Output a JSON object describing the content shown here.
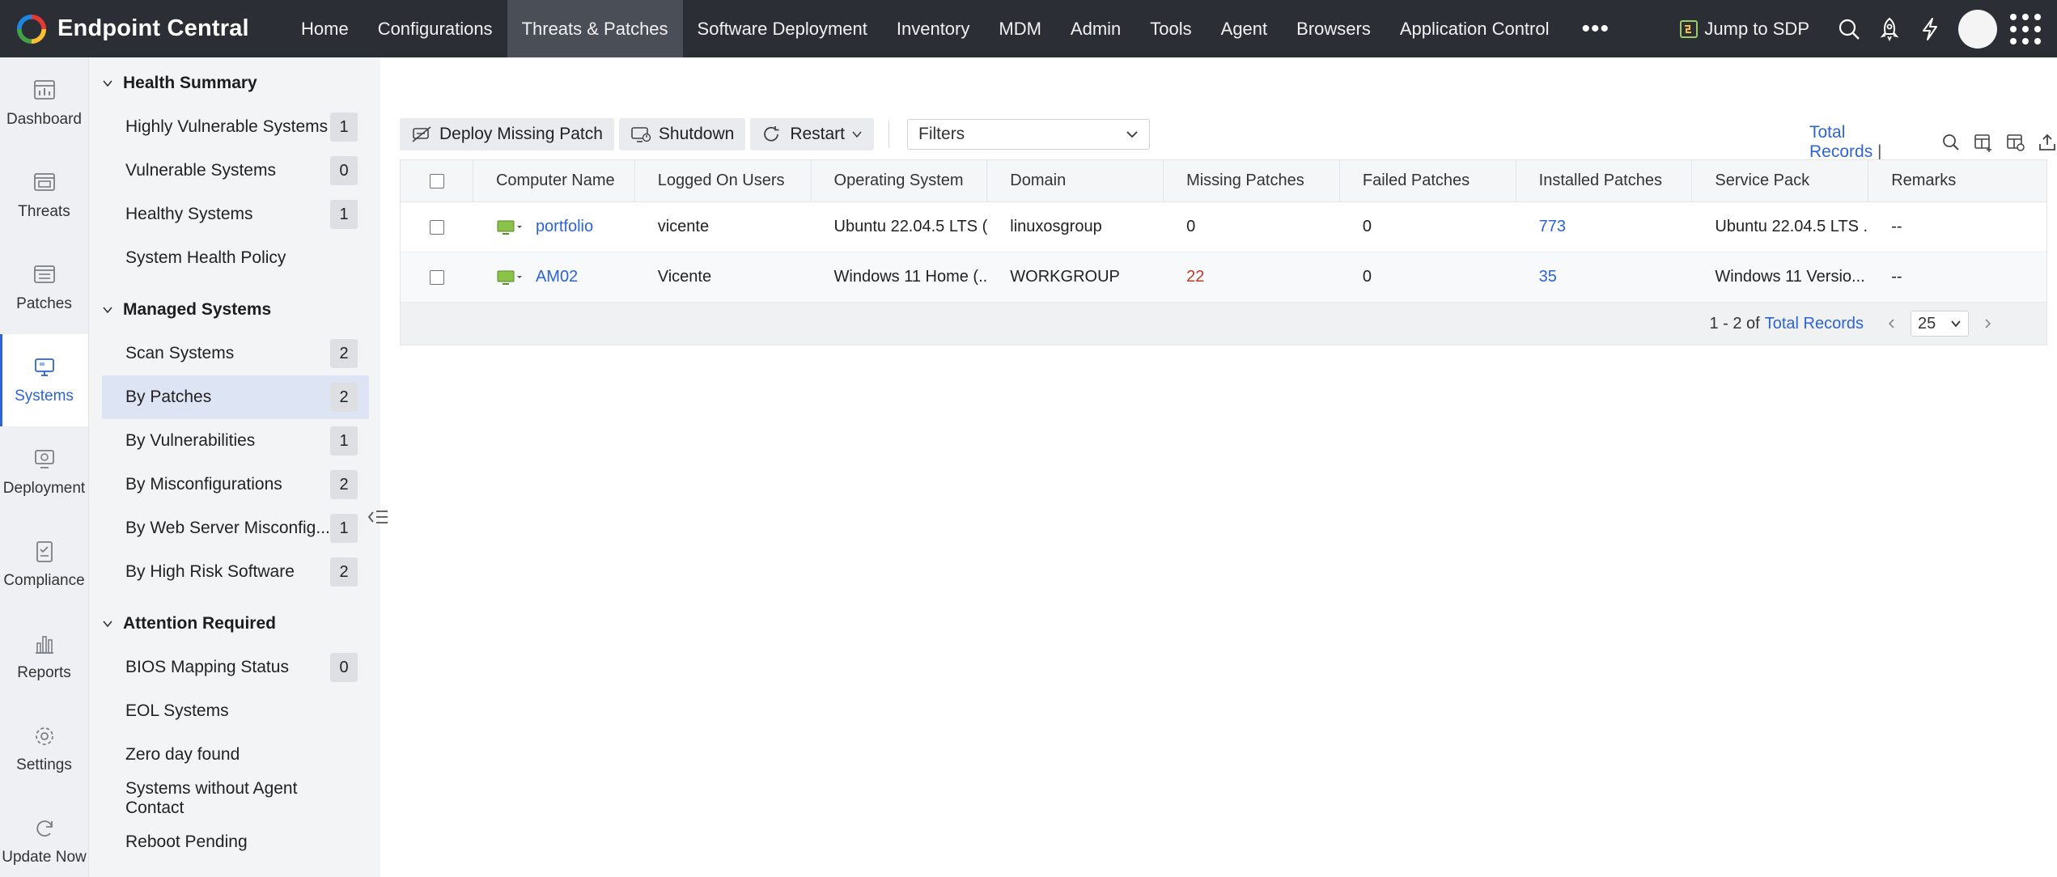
{
  "app": {
    "name": "Endpoint Central"
  },
  "nav": {
    "items": [
      "Home",
      "Configurations",
      "Threats & Patches",
      "Software Deployment",
      "Inventory",
      "MDM",
      "Admin",
      "Tools",
      "Agent",
      "Browsers",
      "Application Control"
    ],
    "active": "Threats & Patches",
    "more": "•••",
    "jump_label": "Jump to SDP"
  },
  "rail": [
    {
      "label": "Dashboard",
      "icon": "dashboard-icon"
    },
    {
      "label": "Threats",
      "icon": "threats-icon"
    },
    {
      "label": "Patches",
      "icon": "patches-icon"
    },
    {
      "label": "Systems",
      "icon": "systems-icon",
      "active": true
    },
    {
      "label": "Deployment",
      "icon": "deployment-icon"
    },
    {
      "label": "Compliance",
      "icon": "compliance-icon"
    },
    {
      "label": "Reports",
      "icon": "reports-icon"
    },
    {
      "label": "Settings",
      "icon": "settings-icon"
    },
    {
      "label": "Update Now",
      "icon": "update-icon"
    }
  ],
  "submenu": {
    "health": {
      "title": "Health Summary",
      "items": [
        {
          "label": "Highly Vulnerable Systems",
          "count": "1"
        },
        {
          "label": "Vulnerable Systems",
          "count": "0"
        },
        {
          "label": "Healthy Systems",
          "count": "1"
        },
        {
          "label": "System Health Policy",
          "count": ""
        }
      ]
    },
    "managed": {
      "title": "Managed Systems",
      "items": [
        {
          "label": "Scan Systems",
          "count": "2"
        },
        {
          "label": "By Patches",
          "count": "2",
          "active": true
        },
        {
          "label": "By Vulnerabilities",
          "count": "1"
        },
        {
          "label": "By Misconfigurations",
          "count": "2"
        },
        {
          "label": "By Web Server Misconfig...",
          "count": "1"
        },
        {
          "label": "By High Risk Software",
          "count": "2"
        }
      ]
    },
    "attention": {
      "title": "Attention Required",
      "items": [
        {
          "label": "BIOS Mapping Status",
          "count": "0"
        },
        {
          "label": "EOL Systems",
          "count": ""
        },
        {
          "label": "Zero day found",
          "count": ""
        },
        {
          "label": "Systems without Agent Contact",
          "count": ""
        },
        {
          "label": "Reboot Pending",
          "count": ""
        }
      ]
    }
  },
  "toolbar": {
    "deploy": "Deploy Missing Patch",
    "shutdown": "Shutdown",
    "restart": "Restart",
    "filters": "Filters",
    "total_records": "Total Records",
    "separator": "|"
  },
  "table": {
    "columns": [
      "Computer Name",
      "Logged On Users",
      "Operating System",
      "Domain",
      "Missing Patches",
      "Failed Patches",
      "Installed Patches",
      "Service Pack",
      "Remarks"
    ],
    "rows": [
      {
        "computer": "portfolio",
        "user": "vicente",
        "os": "Ubuntu 22.04.5 LTS (...",
        "domain": "linuxosgroup",
        "missing": "0",
        "failed": "0",
        "installed": "773",
        "sp": "Ubuntu 22.04.5 LTS ...",
        "remarks": "--"
      },
      {
        "computer": "AM02",
        "user": "Vicente",
        "os": "Windows 11 Home (...",
        "domain": "WORKGROUP",
        "missing": "22",
        "failed": "0",
        "installed": "35",
        "sp": "Windows 11 Versio...",
        "remarks": "--"
      }
    ]
  },
  "pager": {
    "range": "1 - 2 of",
    "total_link": "Total Records",
    "per_page": "25"
  },
  "colors": {
    "topbar": "#2b2f35",
    "accent": "#2c63d6",
    "missing_red": "#c0392b",
    "active_menu": "#dde4f4"
  }
}
